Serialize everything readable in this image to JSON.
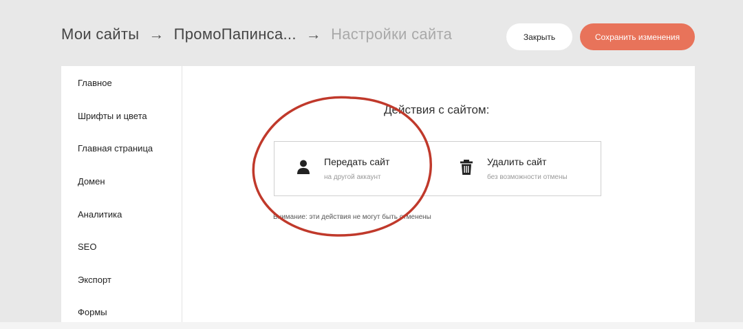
{
  "breadcrumb": {
    "items": [
      "Мои сайты",
      "ПромоПапинса...",
      "Настройки сайта"
    ],
    "separator": "→"
  },
  "header": {
    "close_label": "Закрыть",
    "save_label": "Сохранить изменения"
  },
  "sidebar": {
    "items": [
      {
        "label": "Главное"
      },
      {
        "label": "Шрифты и цвета"
      },
      {
        "label": "Главная страница"
      },
      {
        "label": "Домен"
      },
      {
        "label": "Аналитика"
      },
      {
        "label": "SEO"
      },
      {
        "label": "Экспорт"
      },
      {
        "label": "Формы"
      }
    ]
  },
  "main": {
    "title": "Действия с сайтом:",
    "cards": [
      {
        "title": "Передать сайт",
        "subtitle": "на другой аккаунт",
        "icon": "user-icon"
      },
      {
        "title": "Удалить сайт",
        "subtitle": "без возможности отмены",
        "icon": "trash-icon"
      }
    ],
    "warning": "Внимание: эти действия не могут быть отменены"
  },
  "colors": {
    "accent": "#e8735a",
    "annotation": "#c0392b",
    "background": "#e8e8e8"
  }
}
